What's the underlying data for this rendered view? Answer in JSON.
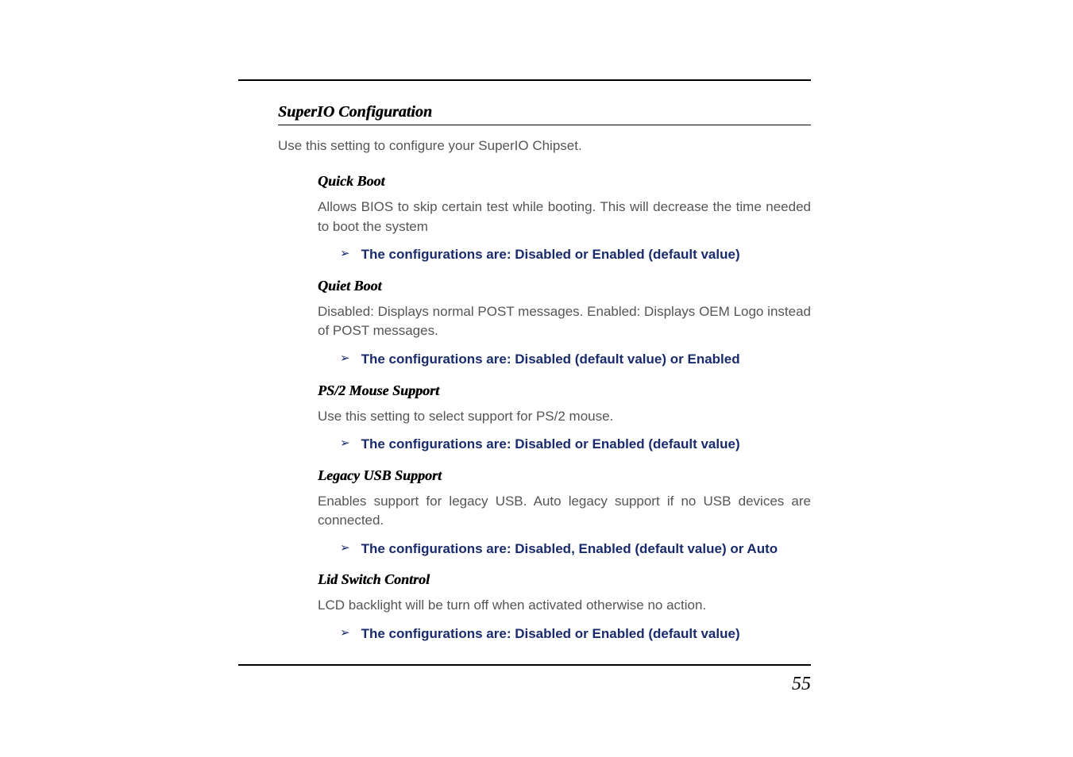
{
  "page_number": "55",
  "section": {
    "title": "SuperIO Configuration",
    "intro": "Use this setting to configure your SuperIO Chipset."
  },
  "items": [
    {
      "title": "Quick Boot",
      "desc": "Allows BIOS to skip certain test while booting.  This will decrease the time needed to boot the system",
      "config": "The configurations are: Disabled or Enabled (default value)"
    },
    {
      "title": "Quiet Boot",
      "desc": "Disabled: Displays normal POST messages.  Enabled: Displays OEM Logo instead of POST messages.",
      "config": "The configurations are: Disabled (default value) or Enabled"
    },
    {
      "title": "PS/2 Mouse Support",
      "desc": "Use this setting to select support for PS/2 mouse.",
      "config": "The configurations are: Disabled or Enabled (default value)"
    },
    {
      "title": "Legacy USB Support",
      "desc": "Enables support for legacy USB.  Auto legacy support if no USB devices are connected.",
      "config": "The configurations are: Disabled, Enabled (default value) or Auto"
    },
    {
      "title": "Lid Switch Control",
      "desc": "LCD backlight will be turn off when activated otherwise no action.",
      "config": "The configurations are: Disabled or Enabled (default value)"
    }
  ]
}
